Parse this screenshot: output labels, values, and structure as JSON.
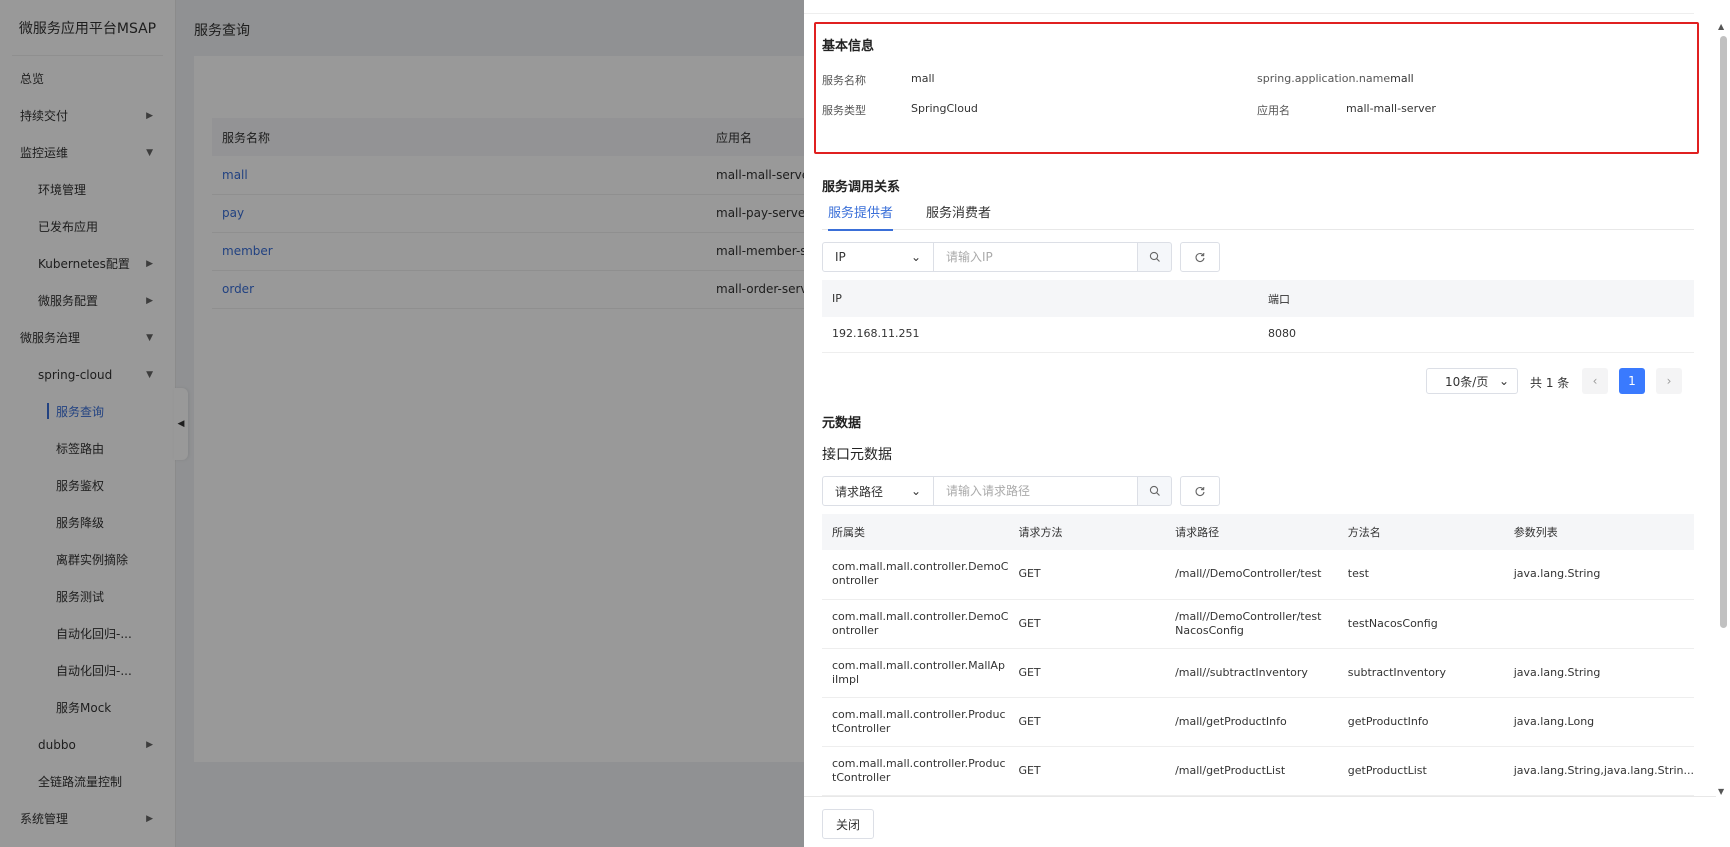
{
  "sidebar": {
    "brand": "微服务应用平台MSAP",
    "items": [
      {
        "label": "总览"
      },
      {
        "label": "持续交付"
      },
      {
        "label": "监控运维"
      },
      {
        "label": "环境管理"
      },
      {
        "label": "已发布应用"
      },
      {
        "label": "Kubernetes配置"
      },
      {
        "label": "微服务配置"
      },
      {
        "label": "微服务治理"
      },
      {
        "label": "spring-cloud"
      },
      {
        "label": "服务查询"
      },
      {
        "label": "标签路由"
      },
      {
        "label": "服务鉴权"
      },
      {
        "label": "服务降级"
      },
      {
        "label": "离群实例摘除"
      },
      {
        "label": "服务测试"
      },
      {
        "label": "自动化回归-..."
      },
      {
        "label": "自动化回归-..."
      },
      {
        "label": "服务Mock"
      },
      {
        "label": "dubbo"
      },
      {
        "label": "全链路流量控制"
      },
      {
        "label": "系统管理"
      }
    ]
  },
  "page": {
    "title": "服务查询",
    "columns": [
      "服务名称",
      "应用名"
    ],
    "rows": [
      {
        "name": "mall",
        "app": "mall-mall-server"
      },
      {
        "name": "pay",
        "app": "mall-pay-server"
      },
      {
        "name": "member",
        "app": "mall-member-server"
      },
      {
        "name": "order",
        "app": "mall-order-server"
      }
    ]
  },
  "drawer": {
    "basic": {
      "title": "基本信息",
      "service_name_label": "服务名称",
      "service_name": "mall",
      "spring_name_label": "spring.application.name",
      "spring_name": "mall",
      "service_type_label": "服务类型",
      "service_type": "SpringCloud",
      "app_name_label": "应用名",
      "app_name": "mall-mall-server"
    },
    "relation": {
      "title": "服务调用关系",
      "tabs": [
        "服务提供者",
        "服务消费者"
      ],
      "select_value": "IP",
      "placeholder": "请输入IP",
      "columns": [
        "IP",
        "端口"
      ],
      "rows": [
        {
          "ip": "192.168.11.251",
          "port": "8080"
        }
      ],
      "pagination": {
        "page_size": "10条/页",
        "total": "共 1 条",
        "current": "1"
      }
    },
    "metadata": {
      "title": "元数据",
      "subtitle": "接口元数据",
      "select_value": "请求路径",
      "placeholder": "请输入请求路径",
      "columns": [
        "所属类",
        "请求方法",
        "请求路径",
        "方法名",
        "参数列表"
      ],
      "rows": [
        {
          "cls1": "com.mall.mall.controller.DemoC",
          "cls2": "ontroller",
          "method": "GET",
          "path1": "/mall//DemoController/test",
          "path2": "",
          "name": "test",
          "params": "java.lang.String"
        },
        {
          "cls1": "com.mall.mall.controller.DemoC",
          "cls2": "ontroller",
          "method": "GET",
          "path1": "/mall//DemoController/test",
          "path2": "NacosConfig",
          "name": "testNacosConfig",
          "params": ""
        },
        {
          "cls1": "com.mall.mall.controller.MallAp",
          "cls2": "iImpl",
          "method": "GET",
          "path1": "/mall//subtractInventory",
          "path2": "",
          "name": "subtractInventory",
          "params": "java.lang.String"
        },
        {
          "cls1": "com.mall.mall.controller.Produc",
          "cls2": "tController",
          "method": "GET",
          "path1": "/mall/getProductInfo",
          "path2": "",
          "name": "getProductInfo",
          "params": "java.lang.Long"
        },
        {
          "cls1": "com.mall.mall.controller.Produc",
          "cls2": "tController",
          "method": "GET",
          "path1": "/mall/getProductList",
          "path2": "",
          "name": "getProductList",
          "params": "java.lang.String,java.lang.Strin..."
        }
      ]
    },
    "close_label": "关闭"
  },
  "colors": {
    "accent": "#3a6fd8",
    "highlight": "#e02020",
    "primary_button": "#3a7afe"
  }
}
